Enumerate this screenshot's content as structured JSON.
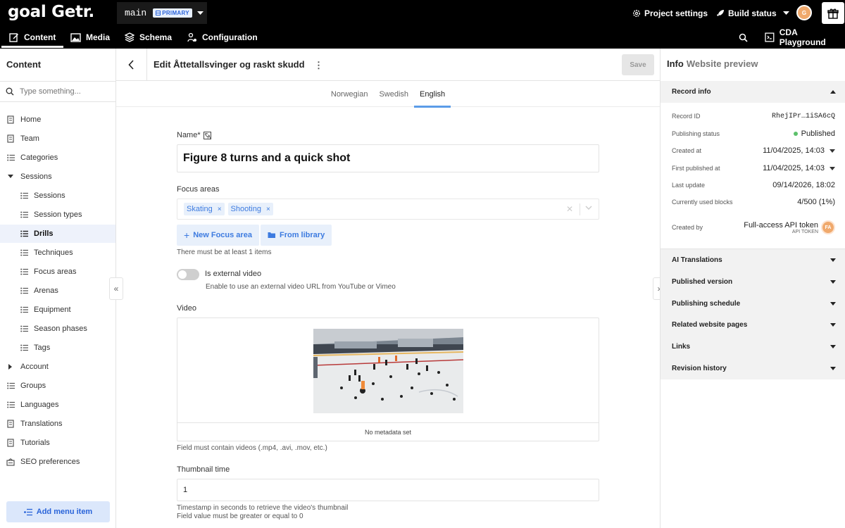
{
  "app": {
    "logo": "goal Getr.",
    "environment": "main",
    "environment_badge": "PRIMARY",
    "project_settings": "Project settings",
    "build_status": "Build status",
    "user_initial": "G",
    "cda_playground": "CDA Playground"
  },
  "nav": {
    "content": "Content",
    "media": "Media",
    "schema": "Schema",
    "configuration": "Configuration"
  },
  "sidebar": {
    "title": "Content",
    "search_placeholder": "Type something...",
    "items": [
      {
        "label": "Home"
      },
      {
        "label": "Team"
      },
      {
        "label": "Categories"
      },
      {
        "label": "Sessions"
      },
      {
        "label": "Sessions"
      },
      {
        "label": "Session types"
      },
      {
        "label": "Drills"
      },
      {
        "label": "Techniques"
      },
      {
        "label": "Focus areas"
      },
      {
        "label": "Arenas"
      },
      {
        "label": "Equipment"
      },
      {
        "label": "Season phases"
      },
      {
        "label": "Tags"
      },
      {
        "label": "Account"
      },
      {
        "label": "Groups"
      },
      {
        "label": "Languages"
      },
      {
        "label": "Translations"
      },
      {
        "label": "Tutorials"
      },
      {
        "label": "SEO preferences"
      }
    ],
    "add_menu_item": "Add menu item"
  },
  "editor": {
    "title": "Edit Åttetallsvinger og raskt skudd",
    "save": "Save",
    "languages": [
      "Norwegian",
      "Swedish",
      "English"
    ],
    "active_language": "English",
    "name_label": "Name*",
    "name_value": "Figure 8 turns and a quick shot",
    "focus_label": "Focus areas",
    "focus_tags": [
      "Skating",
      "Shooting"
    ],
    "new_focus_area": "New Focus area",
    "from_library": "From library",
    "focus_hint": "There must be at least 1 items",
    "external_video_label": "Is external video",
    "external_video_hint": "Enable to use an external video URL from YouTube or Vimeo",
    "external_video_on": false,
    "video_label": "Video",
    "video_meta": "No metadata set",
    "video_hint": "Field must contain videos (.mp4, .avi, .mov, etc.)",
    "thumbnail_label": "Thumbnail time",
    "thumbnail_value": "1",
    "thumbnail_hint1": "Timestamp in seconds to retrieve the video's thumbnail",
    "thumbnail_hint2": "Field value must be greater or equal to 0"
  },
  "info_panel": {
    "tab_info": "Info",
    "tab_preview": "Website preview",
    "record_info": "Record info",
    "rows": [
      {
        "label": "Record ID",
        "value": "RhejIPr…1iSA6cQ"
      },
      {
        "label": "Publishing status",
        "value": "Published"
      },
      {
        "label": "Created at",
        "value": "11/04/2025, 14:03"
      },
      {
        "label": "First published at",
        "value": "11/04/2025, 14:03"
      },
      {
        "label": "Last update",
        "value": "09/14/2026, 18:02"
      },
      {
        "label": "Currently used blocks",
        "value": "4/500 (1%)"
      }
    ],
    "created_by_label": "Created by",
    "created_by_name": "Full-access API token",
    "created_by_type": "API TOKEN",
    "created_by_initials": "FA",
    "sections": [
      "AI Translations",
      "Published version",
      "Publishing schedule",
      "Related website pages",
      "Links",
      "Revision history"
    ],
    "status_color": "#5cc06b"
  },
  "colors": {
    "accent": "#3d7be0",
    "tab_underline": "#5b9ce8"
  }
}
